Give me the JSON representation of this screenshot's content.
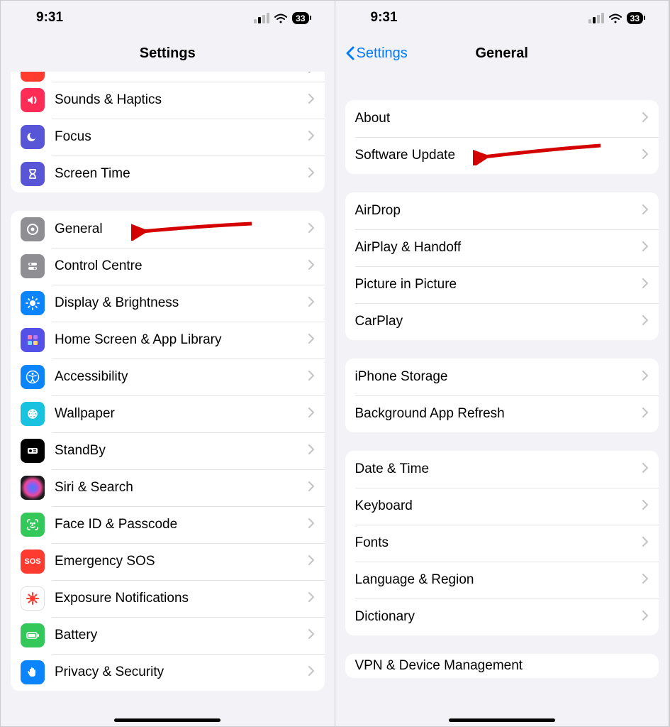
{
  "status": {
    "time": "9:31",
    "battery": "33"
  },
  "left": {
    "title": "Settings",
    "group0": [
      {
        "label": "Sounds & Haptics",
        "icon": "speaker-icon",
        "bg": "#ff3b30"
      },
      {
        "label": "Focus",
        "icon": "moon-icon",
        "bg": "#5856d6"
      },
      {
        "label": "Screen Time",
        "icon": "hourglass-icon",
        "bg": "#5856d6"
      }
    ],
    "group1": [
      {
        "label": "General",
        "icon": "gear-icon",
        "bg": "#8e8e93"
      },
      {
        "label": "Control Centre",
        "icon": "controls-icon",
        "bg": "#8e8e93"
      },
      {
        "label": "Display & Brightness",
        "icon": "brightness-icon",
        "bg": "#0a84ff"
      },
      {
        "label": "Home Screen & App Library",
        "icon": "apps-icon",
        "bg": "#4a4aff"
      },
      {
        "label": "Accessibility",
        "icon": "accessibility-icon",
        "bg": "#0a84ff"
      },
      {
        "label": "Wallpaper",
        "icon": "wallpaper-icon",
        "bg": "#19c2de"
      },
      {
        "label": "StandBy",
        "icon": "standby-icon",
        "bg": "#000000"
      },
      {
        "label": "Siri & Search",
        "icon": "siri-icon",
        "bg": "#1c1c1e"
      },
      {
        "label": "Face ID & Passcode",
        "icon": "faceid-icon",
        "bg": "#34c759"
      },
      {
        "label": "Emergency SOS",
        "icon": "sos-icon",
        "bg": "#ff3b30"
      },
      {
        "label": "Exposure Notifications",
        "icon": "virus-icon",
        "bg": "#ffffff"
      },
      {
        "label": "Battery",
        "icon": "battery-icon",
        "bg": "#34c759"
      },
      {
        "label": "Privacy & Security",
        "icon": "hand-icon",
        "bg": "#0a84ff"
      }
    ]
  },
  "right": {
    "back": "Settings",
    "title": "General",
    "g1": [
      "About",
      "Software Update"
    ],
    "g2": [
      "AirDrop",
      "AirPlay & Handoff",
      "Picture in Picture",
      "CarPlay"
    ],
    "g3": [
      "iPhone Storage",
      "Background App Refresh"
    ],
    "g4": [
      "Date & Time",
      "Keyboard",
      "Fonts",
      "Language & Region",
      "Dictionary"
    ],
    "g5": [
      "VPN & Device Management"
    ]
  }
}
